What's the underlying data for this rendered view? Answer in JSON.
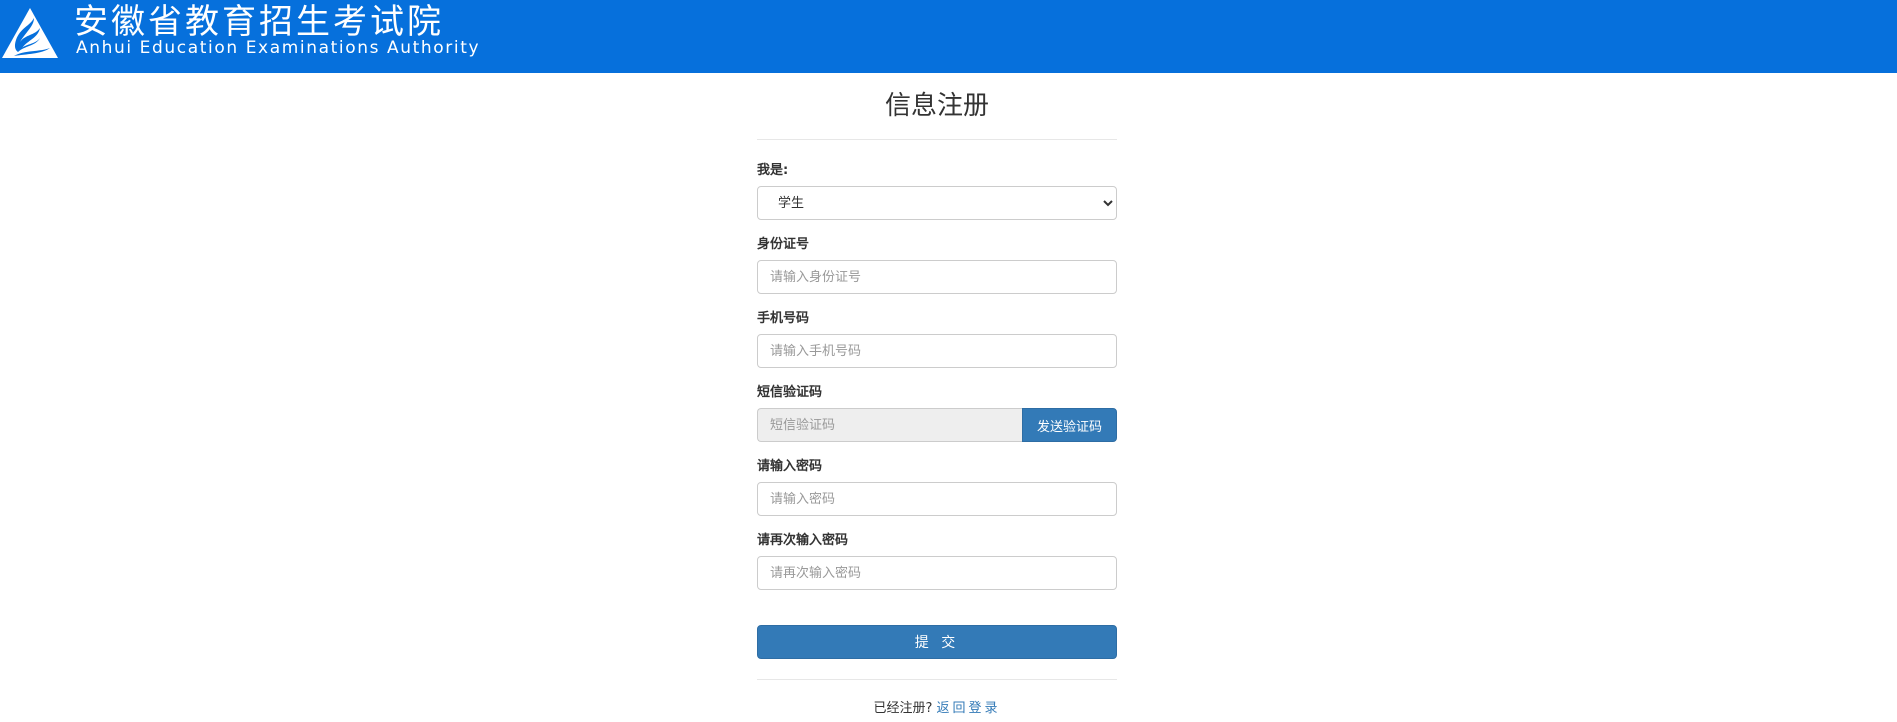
{
  "header": {
    "logo_icon": "aeea-logo-icon",
    "title_cn": "安徽省教育招生考试院",
    "title_en": "Anhui Education Examinations Authority",
    "background_color": "#0670dc"
  },
  "form": {
    "title": "信息注册",
    "identity": {
      "label": "我是:",
      "selected": "学生"
    },
    "id_number": {
      "label": "身份证号",
      "placeholder": "请输入身份证号"
    },
    "phone": {
      "label": "手机号码",
      "placeholder": "请输入手机号码"
    },
    "sms_code": {
      "label": "短信验证码",
      "placeholder": "短信验证码",
      "button_label": "发送验证码"
    },
    "password": {
      "label": "请输入密码",
      "placeholder": "请输入密码"
    },
    "password_confirm": {
      "label": "请再次输入密码",
      "placeholder": "请再次输入密码"
    },
    "submit_label": "提 交",
    "footer": {
      "prompt": "已经注册?",
      "link_label": "返回登录"
    },
    "accent_color": "#337ab7"
  }
}
